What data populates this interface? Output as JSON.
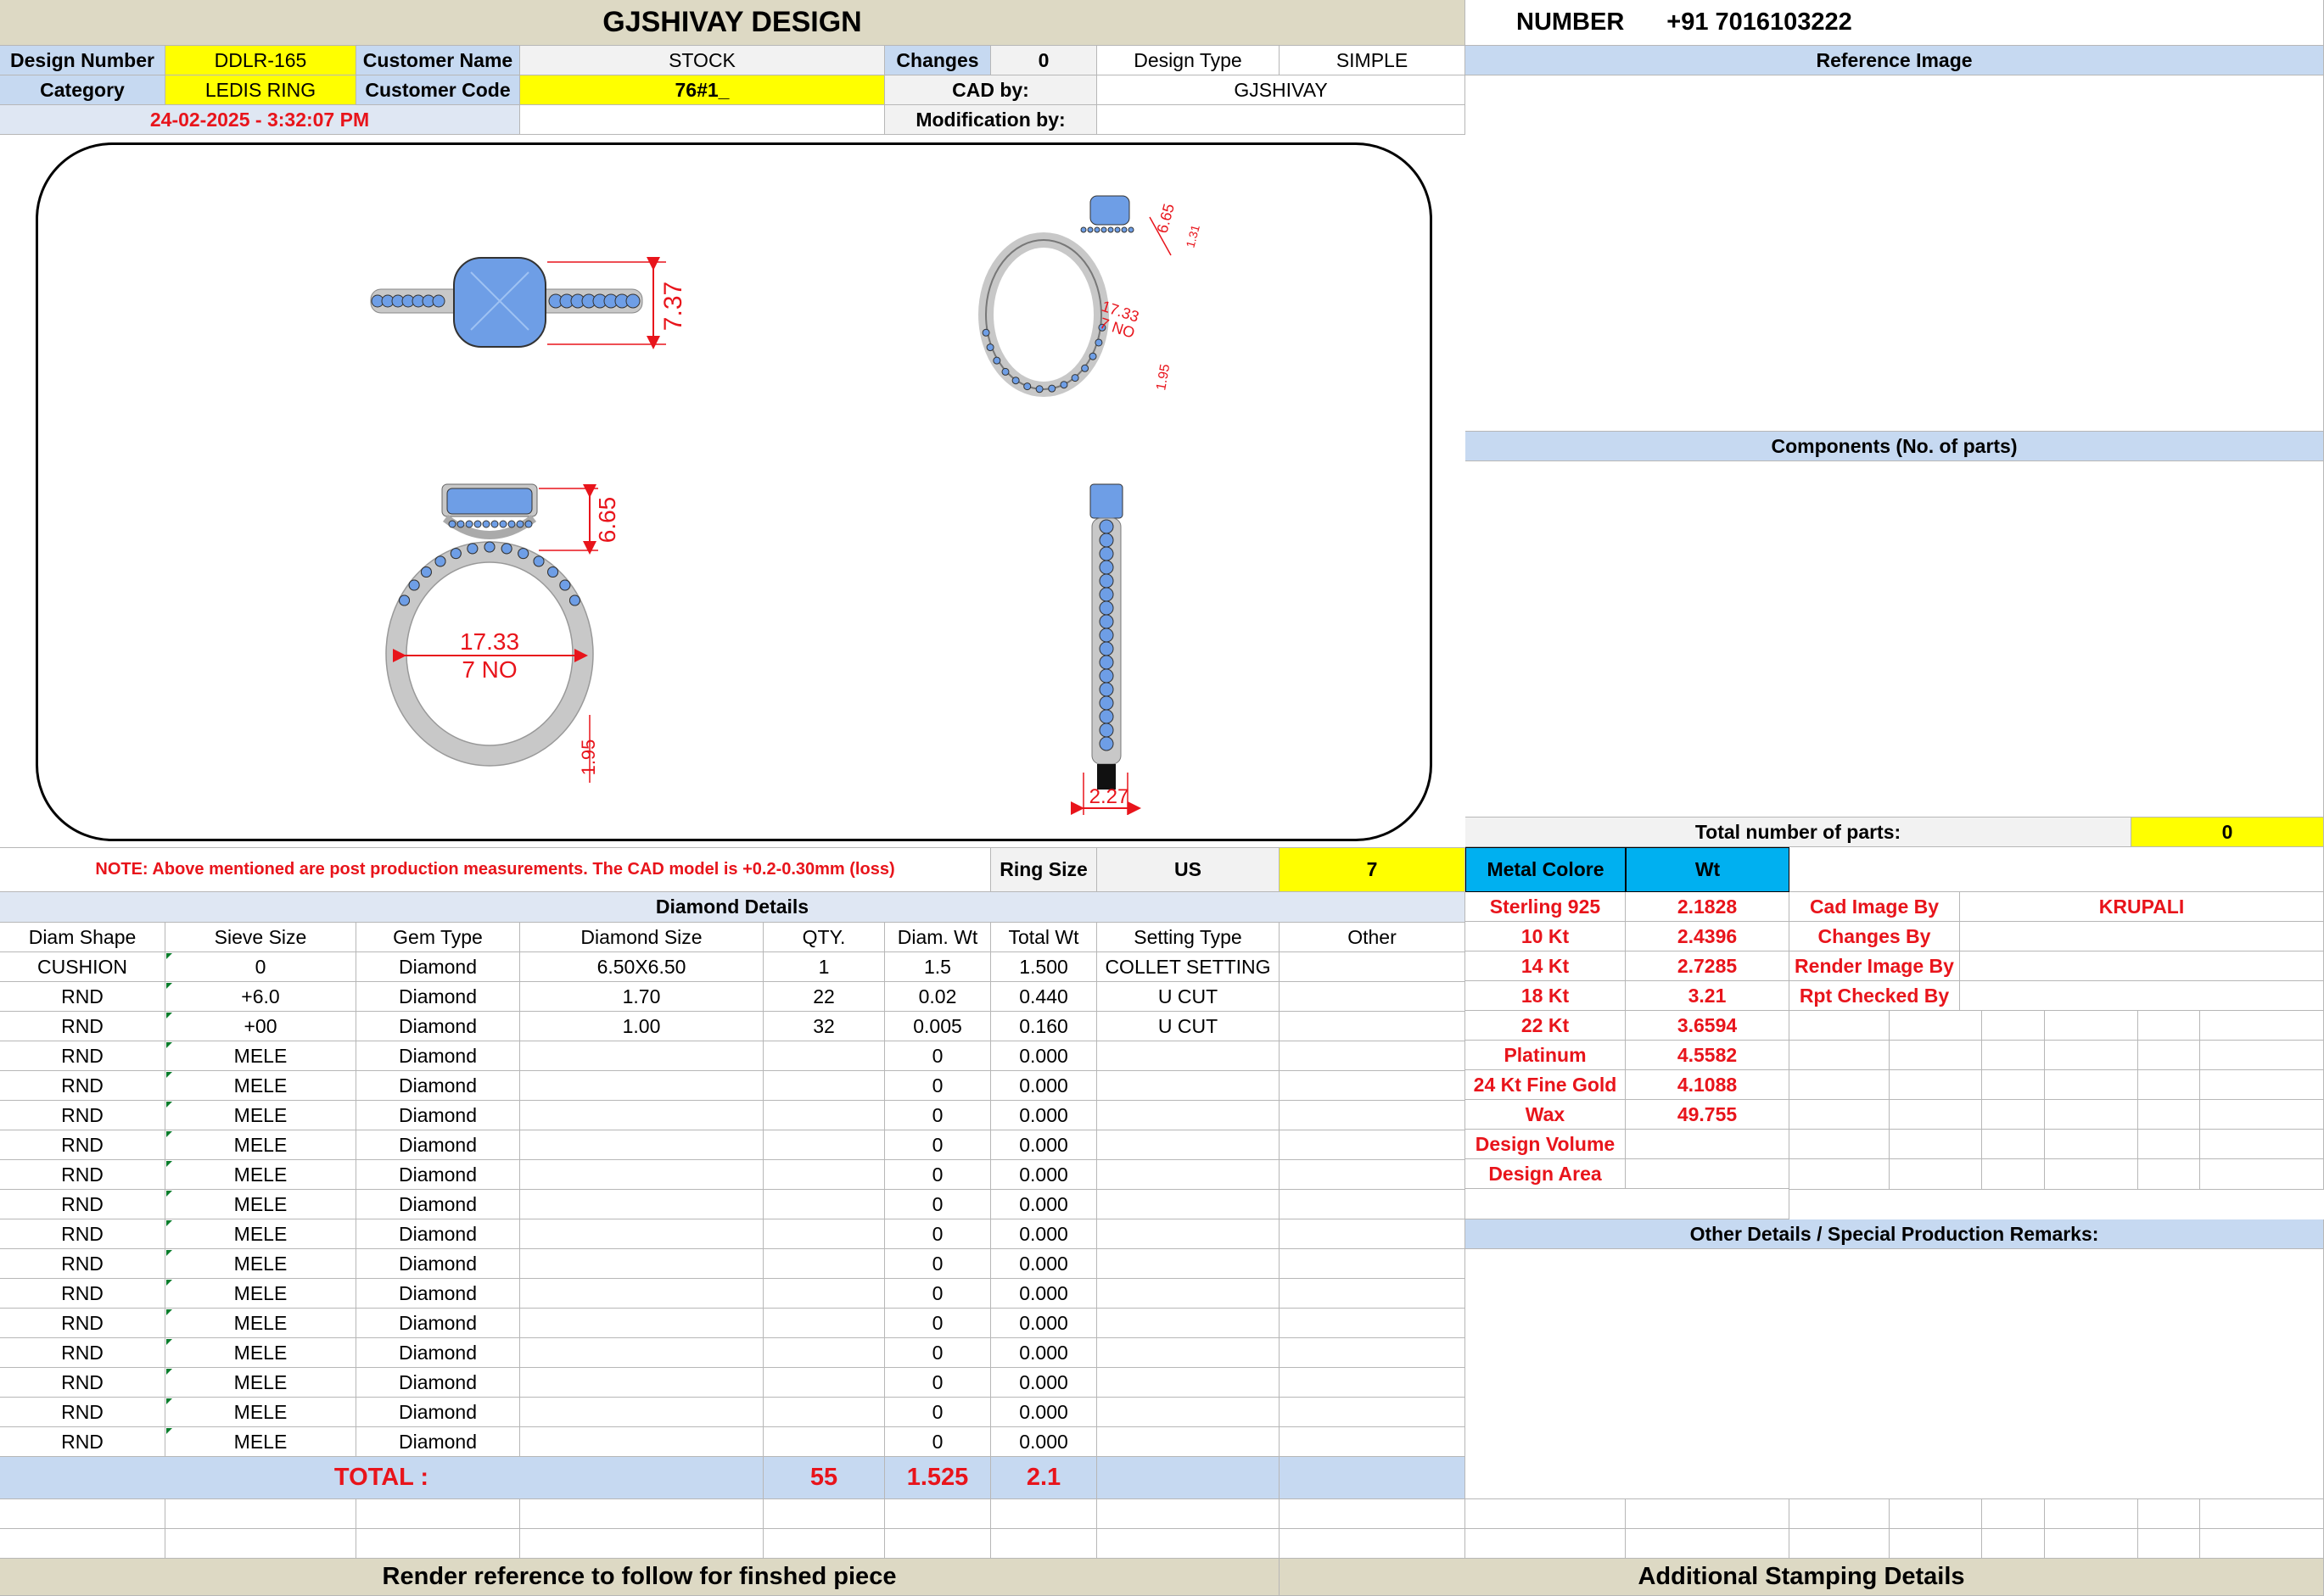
{
  "header": {
    "title": "GJSHIVAY DESIGN",
    "number_label": "NUMBER",
    "number_value": "+91 7016103222"
  },
  "info": {
    "design_number_label": "Design Number",
    "design_number": "DDLR-165",
    "customer_name_label": "Customer Name",
    "customer_name": "STOCK",
    "changes_label": "Changes",
    "changes": "0",
    "design_type_label": "Design Type",
    "design_type": "SIMPLE",
    "category_label": "Category",
    "category": "LEDIS RING",
    "customer_code_label": "Customer Code",
    "customer_code": "76#1_",
    "cad_by_label": "CAD by:",
    "cad_by": "GJSHIVAY",
    "datetime": "24-02-2025 - 3:32:07 PM",
    "modification_label": "Modification by:"
  },
  "drawing": {
    "top_height": "7.37",
    "persp_height": "6.65",
    "persp_small": "1.31",
    "persp_size": "17.33",
    "persp_no": "7 NO",
    "persp_band": "1.95",
    "front_height": "6.65",
    "front_size": "17.33",
    "front_no": "7 NO",
    "front_band": "1.95",
    "side_width": "2.27",
    "colors": {
      "metal": "#c8c8c8",
      "stone": "#6e9ee6",
      "dim": "#e8141b"
    }
  },
  "note": {
    "text": "NOTE: Above mentioned are post production measurements. The CAD model is +0.2-0.30mm (loss)",
    "ring_size_label": "Ring Size",
    "ring_size_unit": "US",
    "ring_size": "7"
  },
  "right": {
    "reference_image": "Reference Image",
    "components": "Components (No. of parts)",
    "total_parts_label": "Total number of parts:",
    "total_parts": "0",
    "metal_colore": "Metal Colore",
    "wt": "Wt",
    "metals": [
      {
        "name": "Sterling 925",
        "wt": "2.1828"
      },
      {
        "name": "10 Kt",
        "wt": "2.4396"
      },
      {
        "name": "14 Kt",
        "wt": "2.7285"
      },
      {
        "name": "18 Kt",
        "wt": "3.21"
      },
      {
        "name": "22 Kt",
        "wt": "3.6594"
      },
      {
        "name": "Platinum",
        "wt": "4.5582"
      },
      {
        "name": "24 Kt Fine Gold",
        "wt": "4.1088"
      },
      {
        "name": "Wax",
        "wt": "49.755"
      },
      {
        "name": "Design Volume",
        "wt": ""
      },
      {
        "name": "Design Area",
        "wt": ""
      }
    ],
    "credits": [
      {
        "label": "Cad Image By",
        "value": "KRUPALI"
      },
      {
        "label": "Changes By",
        "value": ""
      },
      {
        "label": "Render Image By",
        "value": ""
      },
      {
        "label": "Rpt Checked By",
        "value": ""
      }
    ],
    "other_details": "Other Details / Special Production Remarks:"
  },
  "diamonds": {
    "title": "Diamond Details",
    "columns": [
      "Diam Shape",
      "Sieve Size",
      "Gem Type",
      "Diamond Size",
      "QTY.",
      "Diam. Wt",
      "Total Wt",
      "Setting Type",
      "Other"
    ],
    "rows": [
      [
        "CUSHION",
        "0",
        "Diamond",
        "6.50X6.50",
        "1",
        "1.5",
        "1.500",
        "COLLET SETTING",
        ""
      ],
      [
        "RND",
        "+6.0",
        "Diamond",
        "1.70",
        "22",
        "0.02",
        "0.440",
        "U CUT",
        ""
      ],
      [
        "RND",
        "+00",
        "Diamond",
        "1.00",
        "32",
        "0.005",
        "0.160",
        "U CUT",
        ""
      ],
      [
        "RND",
        "MELE",
        "Diamond",
        "",
        "",
        "0",
        "0.000",
        "",
        ""
      ],
      [
        "RND",
        "MELE",
        "Diamond",
        "",
        "",
        "0",
        "0.000",
        "",
        ""
      ],
      [
        "RND",
        "MELE",
        "Diamond",
        "",
        "",
        "0",
        "0.000",
        "",
        ""
      ],
      [
        "RND",
        "MELE",
        "Diamond",
        "",
        "",
        "0",
        "0.000",
        "",
        ""
      ],
      [
        "RND",
        "MELE",
        "Diamond",
        "",
        "",
        "0",
        "0.000",
        "",
        ""
      ],
      [
        "RND",
        "MELE",
        "Diamond",
        "",
        "",
        "0",
        "0.000",
        "",
        ""
      ],
      [
        "RND",
        "MELE",
        "Diamond",
        "",
        "",
        "0",
        "0.000",
        "",
        ""
      ],
      [
        "RND",
        "MELE",
        "Diamond",
        "",
        "",
        "0",
        "0.000",
        "",
        ""
      ],
      [
        "RND",
        "MELE",
        "Diamond",
        "",
        "",
        "0",
        "0.000",
        "",
        ""
      ],
      [
        "RND",
        "MELE",
        "Diamond",
        "",
        "",
        "0",
        "0.000",
        "",
        ""
      ],
      [
        "RND",
        "MELE",
        "Diamond",
        "",
        "",
        "0",
        "0.000",
        "",
        ""
      ],
      [
        "RND",
        "MELE",
        "Diamond",
        "",
        "",
        "0",
        "0.000",
        "",
        ""
      ],
      [
        "RND",
        "MELE",
        "Diamond",
        "",
        "",
        "0",
        "0.000",
        "",
        ""
      ],
      [
        "RND",
        "MELE",
        "Diamond",
        "",
        "",
        "0",
        "0.000",
        "",
        ""
      ]
    ],
    "total_label": "TOTAL :",
    "total_qty": "55",
    "total_diam_wt": "1.525",
    "total_wt": "2.1"
  },
  "footer": {
    "render_reference": "Render reference to follow for finshed piece",
    "stamping": "Additional Stamping Details"
  }
}
